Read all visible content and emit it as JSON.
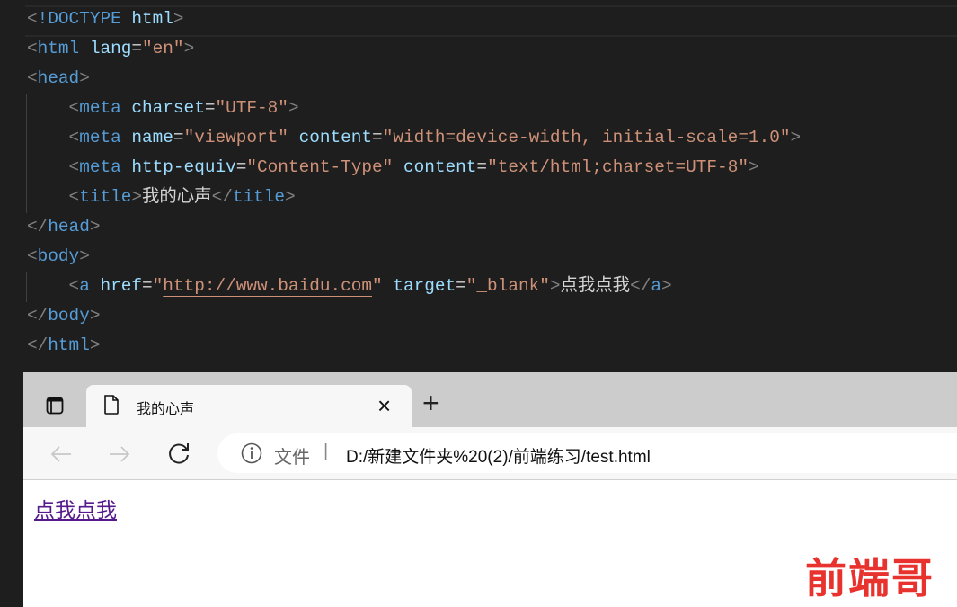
{
  "editor": {
    "lines": [
      [
        [
          "p",
          "<"
        ],
        [
          "t",
          "!DOCTYPE"
        ],
        [
          "x",
          " "
        ],
        [
          "a",
          "html"
        ],
        [
          "p",
          ">"
        ]
      ],
      [
        [
          "p",
          "<"
        ],
        [
          "t",
          "html"
        ],
        [
          "x",
          " "
        ],
        [
          "a",
          "lang"
        ],
        [
          "x",
          "="
        ],
        [
          "s",
          "\"en\""
        ],
        [
          "p",
          ">"
        ]
      ],
      [
        [
          "p",
          "<"
        ],
        [
          "t",
          "head"
        ],
        [
          "p",
          ">"
        ]
      ],
      [
        [
          "x",
          "    "
        ],
        [
          "p",
          "<"
        ],
        [
          "t",
          "meta"
        ],
        [
          "x",
          " "
        ],
        [
          "a",
          "charset"
        ],
        [
          "x",
          "="
        ],
        [
          "s",
          "\"UTF-8\""
        ],
        [
          "p",
          ">"
        ]
      ],
      [
        [
          "x",
          "    "
        ],
        [
          "p",
          "<"
        ],
        [
          "t",
          "meta"
        ],
        [
          "x",
          " "
        ],
        [
          "a",
          "name"
        ],
        [
          "x",
          "="
        ],
        [
          "s",
          "\"viewport\""
        ],
        [
          "x",
          " "
        ],
        [
          "a",
          "content"
        ],
        [
          "x",
          "="
        ],
        [
          "s",
          "\"width=device-width, initial-scale=1.0\""
        ],
        [
          "p",
          ">"
        ]
      ],
      [
        [
          "x",
          "    "
        ],
        [
          "p",
          "<"
        ],
        [
          "t",
          "meta"
        ],
        [
          "x",
          " "
        ],
        [
          "a",
          "http-equiv"
        ],
        [
          "x",
          "="
        ],
        [
          "s",
          "\"Content-Type\""
        ],
        [
          "x",
          " "
        ],
        [
          "a",
          "content"
        ],
        [
          "x",
          "="
        ],
        [
          "s",
          "\"text/html;charset=UTF-8\""
        ],
        [
          "p",
          ">"
        ]
      ],
      [
        [
          "x",
          "    "
        ],
        [
          "p",
          "<"
        ],
        [
          "t",
          "title"
        ],
        [
          "p",
          ">"
        ],
        [
          "x",
          "我的心声"
        ],
        [
          "p",
          "</"
        ],
        [
          "t",
          "title"
        ],
        [
          "p",
          ">"
        ]
      ],
      [
        [
          "p",
          "</"
        ],
        [
          "t",
          "head"
        ],
        [
          "p",
          ">"
        ]
      ],
      [
        [
          "p",
          "<"
        ],
        [
          "t",
          "body"
        ],
        [
          "p",
          ">"
        ]
      ],
      [
        [
          "x",
          "    "
        ],
        [
          "p",
          "<"
        ],
        [
          "t",
          "a"
        ],
        [
          "x",
          " "
        ],
        [
          "a",
          "href"
        ],
        [
          "x",
          "="
        ],
        [
          "s",
          "\""
        ],
        [
          "su",
          "http://www.baidu.com"
        ],
        [
          "s",
          "\""
        ],
        [
          "x",
          " "
        ],
        [
          "a",
          "target"
        ],
        [
          "x",
          "="
        ],
        [
          "s",
          "\"_blank\""
        ],
        [
          "p",
          ">"
        ],
        [
          "x",
          "点我点我"
        ],
        [
          "p",
          "</"
        ],
        [
          "t",
          "a"
        ],
        [
          "p",
          ">"
        ]
      ],
      [
        [
          "p",
          "</"
        ],
        [
          "t",
          "body"
        ],
        [
          "p",
          ">"
        ]
      ],
      [
        [
          "p",
          "</"
        ],
        [
          "t",
          "html"
        ],
        [
          "p",
          ">"
        ]
      ]
    ]
  },
  "browser": {
    "tab_title": "我的心声",
    "new_tab": "+",
    "close": "×",
    "address_label": "文件",
    "address_sep": "|",
    "url": "D:/新建文件夹%20(2)/前端练习/test.html",
    "link_text": "点我点我",
    "link_color": "#551a8b"
  },
  "watermark": "前端哥",
  "watermark_color": "#e8322e"
}
